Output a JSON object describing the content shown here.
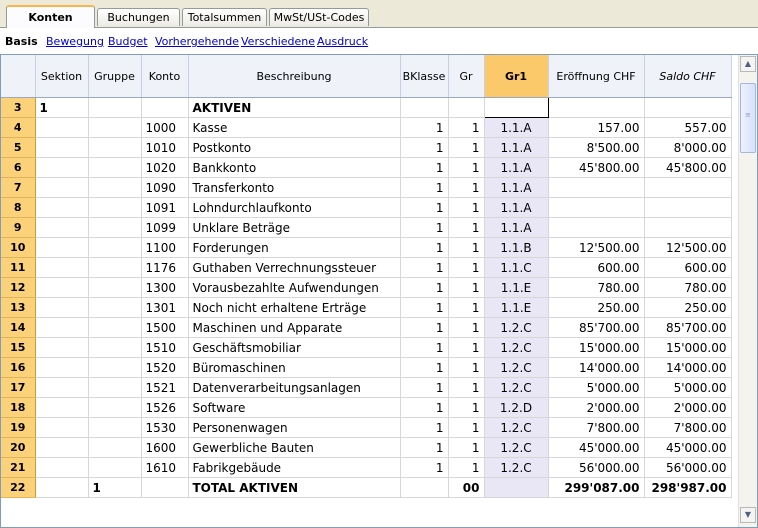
{
  "tabs": [
    {
      "label": "Konten"
    },
    {
      "label": "Buchungen"
    },
    {
      "label": "Totalsummen"
    },
    {
      "label": "MwSt/USt-Codes"
    }
  ],
  "views": {
    "basis": "Basis",
    "links": [
      "Bewegung",
      "Budget",
      "Vorhergehende",
      "Verschiedene",
      "Ausdruck"
    ]
  },
  "columns": [
    "Sektion",
    "Gruppe",
    "Konto",
    "Beschreibung",
    "BKlasse",
    "Gr",
    "Gr1",
    "Eröffnung CHF",
    "Saldo CHF"
  ],
  "rows": [
    {
      "n": "3",
      "sektion": "1",
      "gruppe": "",
      "konto": "",
      "desc": "AKTIVEN",
      "bk": "",
      "gr": "",
      "gr1": "",
      "eroeff": "",
      "saldo": "",
      "bold": true,
      "sel": true
    },
    {
      "n": "4",
      "sektion": "",
      "gruppe": "",
      "konto": "1000",
      "desc": "Kasse",
      "bk": "1",
      "gr": "1",
      "gr1": "1.1.A",
      "eroeff": "157.00",
      "saldo": "557.00"
    },
    {
      "n": "5",
      "sektion": "",
      "gruppe": "",
      "konto": "1010",
      "desc": "Postkonto",
      "bk": "1",
      "gr": "1",
      "gr1": "1.1.A",
      "eroeff": "8'500.00",
      "saldo": "8'000.00"
    },
    {
      "n": "6",
      "sektion": "",
      "gruppe": "",
      "konto": "1020",
      "desc": "Bankkonto",
      "bk": "1",
      "gr": "1",
      "gr1": "1.1.A",
      "eroeff": "45'800.00",
      "saldo": "45'800.00"
    },
    {
      "n": "7",
      "sektion": "",
      "gruppe": "",
      "konto": "1090",
      "desc": "Transferkonto",
      "bk": "1",
      "gr": "1",
      "gr1": "1.1.A",
      "eroeff": "",
      "saldo": ""
    },
    {
      "n": "8",
      "sektion": "",
      "gruppe": "",
      "konto": "1091",
      "desc": "Lohndurchlaufkonto",
      "bk": "1",
      "gr": "1",
      "gr1": "1.1.A",
      "eroeff": "",
      "saldo": ""
    },
    {
      "n": "9",
      "sektion": "",
      "gruppe": "",
      "konto": "1099",
      "desc": "Unklare Beträge",
      "bk": "1",
      "gr": "1",
      "gr1": "1.1.A",
      "eroeff": "",
      "saldo": ""
    },
    {
      "n": "10",
      "sektion": "",
      "gruppe": "",
      "konto": "1100",
      "desc": "Forderungen",
      "bk": "1",
      "gr": "1",
      "gr1": "1.1.B",
      "eroeff": "12'500.00",
      "saldo": "12'500.00"
    },
    {
      "n": "11",
      "sektion": "",
      "gruppe": "",
      "konto": "1176",
      "desc": "Guthaben Verrechnungssteuer",
      "bk": "1",
      "gr": "1",
      "gr1": "1.1.C",
      "eroeff": "600.00",
      "saldo": "600.00"
    },
    {
      "n": "12",
      "sektion": "",
      "gruppe": "",
      "konto": "1300",
      "desc": "Vorausbezahlte Aufwendungen",
      "bk": "1",
      "gr": "1",
      "gr1": "1.1.E",
      "eroeff": "780.00",
      "saldo": "780.00"
    },
    {
      "n": "13",
      "sektion": "",
      "gruppe": "",
      "konto": "1301",
      "desc": "Noch nicht erhaltene Erträge",
      "bk": "1",
      "gr": "1",
      "gr1": "1.1.E",
      "eroeff": "250.00",
      "saldo": "250.00"
    },
    {
      "n": "14",
      "sektion": "",
      "gruppe": "",
      "konto": "1500",
      "desc": "Maschinen und Apparate",
      "bk": "1",
      "gr": "1",
      "gr1": "1.2.C",
      "eroeff": "85'700.00",
      "saldo": "85'700.00"
    },
    {
      "n": "15",
      "sektion": "",
      "gruppe": "",
      "konto": "1510",
      "desc": "Geschäftsmobiliar",
      "bk": "1",
      "gr": "1",
      "gr1": "1.2.C",
      "eroeff": "15'000.00",
      "saldo": "15'000.00"
    },
    {
      "n": "16",
      "sektion": "",
      "gruppe": "",
      "konto": "1520",
      "desc": "Büromaschinen",
      "bk": "1",
      "gr": "1",
      "gr1": "1.2.C",
      "eroeff": "14'000.00",
      "saldo": "14'000.00"
    },
    {
      "n": "17",
      "sektion": "",
      "gruppe": "",
      "konto": "1521",
      "desc": "Datenverarbeitungsanlagen",
      "bk": "1",
      "gr": "1",
      "gr1": "1.2.C",
      "eroeff": "5'000.00",
      "saldo": "5'000.00"
    },
    {
      "n": "18",
      "sektion": "",
      "gruppe": "",
      "konto": "1526",
      "desc": "Software",
      "bk": "1",
      "gr": "1",
      "gr1": "1.2.D",
      "eroeff": "2'000.00",
      "saldo": "2'000.00"
    },
    {
      "n": "19",
      "sektion": "",
      "gruppe": "",
      "konto": "1530",
      "desc": "Personenwagen",
      "bk": "1",
      "gr": "1",
      "gr1": "1.2.C",
      "eroeff": "7'800.00",
      "saldo": "7'800.00"
    },
    {
      "n": "20",
      "sektion": "",
      "gruppe": "",
      "konto": "1600",
      "desc": "Gewerbliche Bauten",
      "bk": "1",
      "gr": "1",
      "gr1": "1.2.C",
      "eroeff": "45'000.00",
      "saldo": "45'000.00"
    },
    {
      "n": "21",
      "sektion": "",
      "gruppe": "",
      "konto": "1610",
      "desc": "Fabrikgebäude",
      "bk": "1",
      "gr": "1",
      "gr1": "1.2.C",
      "eroeff": "56'000.00",
      "saldo": "56'000.00"
    },
    {
      "n": "22",
      "sektion": "",
      "gruppe": "1",
      "konto": "",
      "desc": "TOTAL AKTIVEN",
      "bk": "",
      "gr": "00",
      "gr1": "",
      "eroeff": "299'087.00",
      "saldo": "298'987.00",
      "bold": true
    }
  ],
  "scrollbar": {
    "up": "▲",
    "down": "▼",
    "grip": "≡"
  }
}
